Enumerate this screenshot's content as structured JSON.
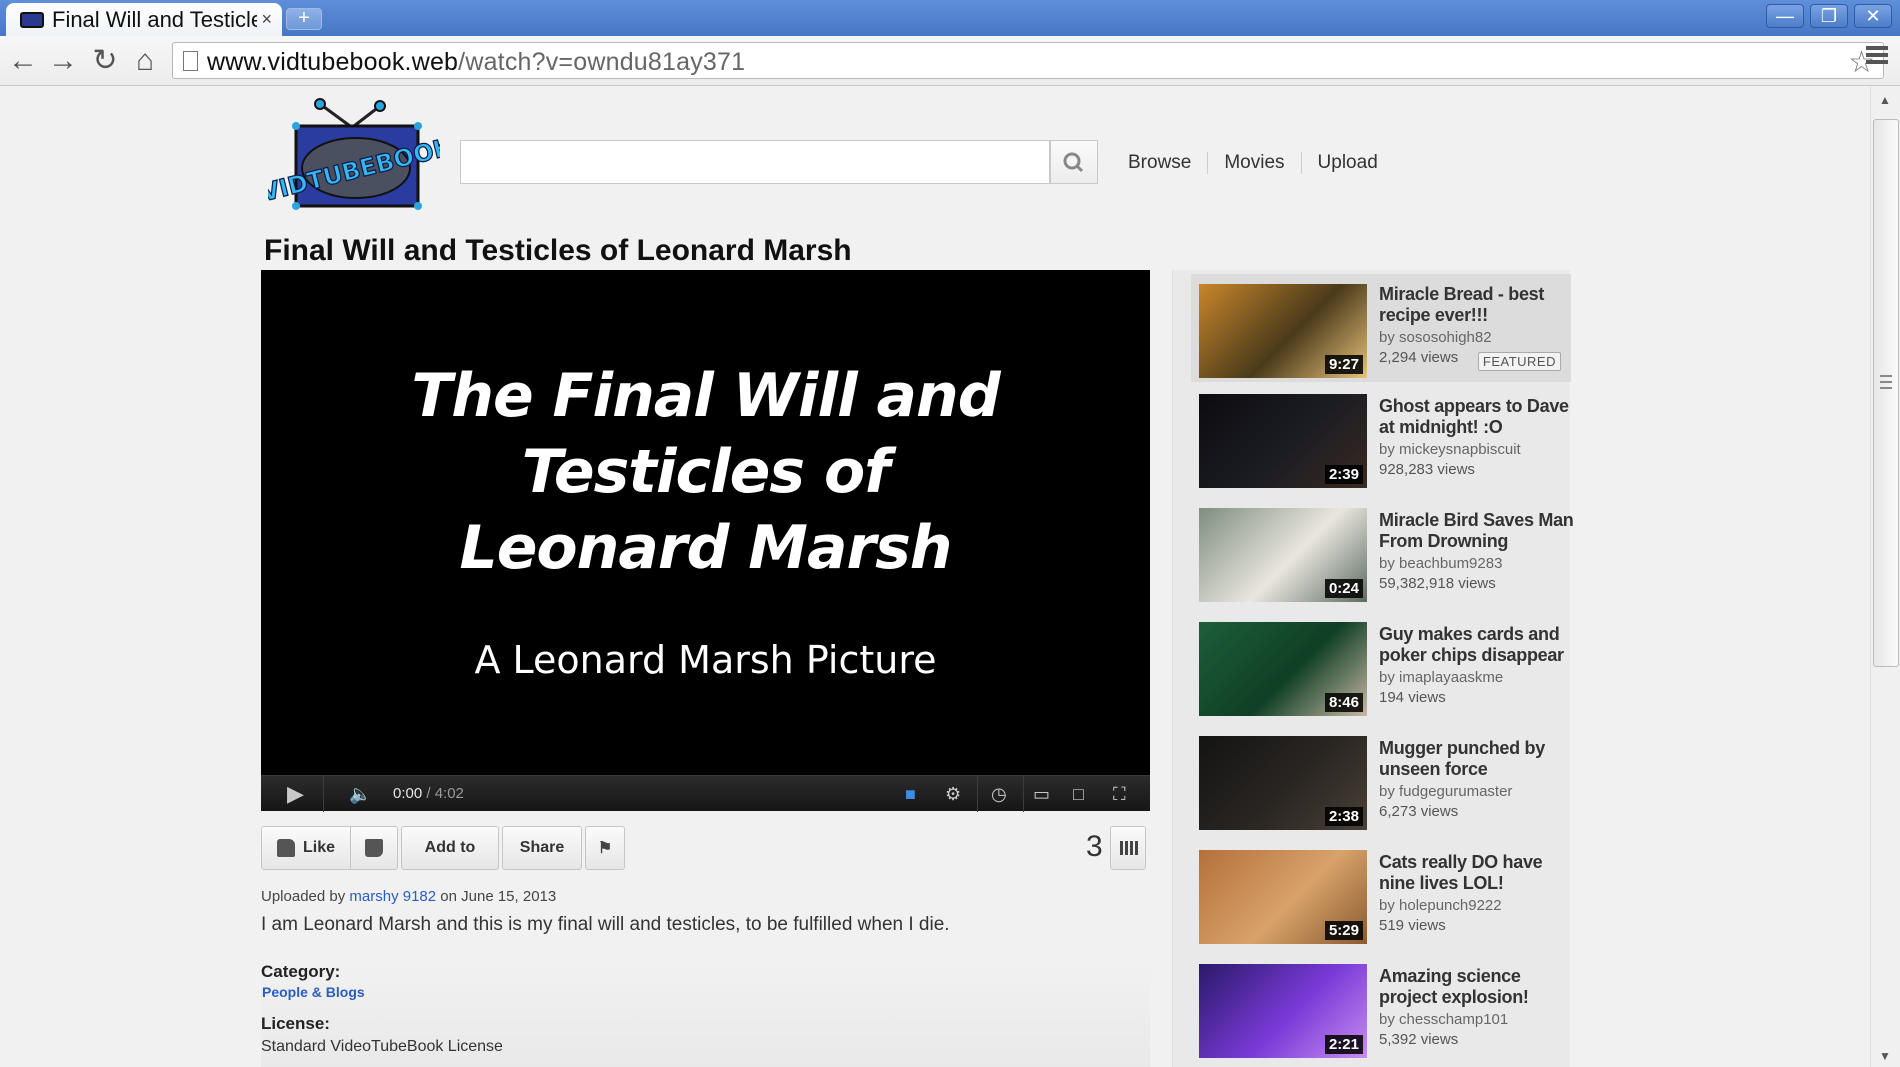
{
  "browser": {
    "tab_title": "Final Will and Testicle",
    "tab_close": "×",
    "new_tab": "+",
    "url_host": "www.vidtubebook.web",
    "url_path": "/watch?v=owndu81ay371"
  },
  "site": {
    "logo_text": "VIDTUBEBOOK",
    "search_placeholder": "",
    "nav": [
      "Browse",
      "Movies",
      "Upload"
    ]
  },
  "video": {
    "title": "Final Will and Testicles of Leonard Marsh",
    "screen_line1": "The Final Will and",
    "screen_line2": "Testicles of",
    "screen_line3": "Leonard Marsh",
    "screen_sub": "A Leonard Marsh Picture",
    "time_current": "0:00",
    "time_total": " / 4:02",
    "views": "3",
    "actions": {
      "like": "Like",
      "add_to": "Add to",
      "share": "Share"
    },
    "uploaded_prefix": "Uploaded by ",
    "uploader": "marshy 9182",
    "uploaded_suffix": " on June 15, 2013",
    "description": "I am Leonard Marsh and this is my final will and testicles, to be fulfilled when I die.",
    "category_label": "Category:",
    "category": "People & Blogs",
    "license_label": "License:",
    "license": "Standard VideoTubeBook License"
  },
  "recommended": [
    {
      "title": "Miracle Bread - best recipe ever!!!",
      "by": "by sososohigh82",
      "views": "2,294 views",
      "duration": "9:27",
      "badge": "FEATURED",
      "thumb_colors": [
        "#c8862b",
        "#4a3a1a",
        "#e7c27a"
      ]
    },
    {
      "title": "Ghost appears to Dave at midnight! :O",
      "by": "by mickeysnapbiscuit",
      "views": "928,283 views",
      "duration": "2:39",
      "thumb_colors": [
        "#0c0c10",
        "#1c1c24",
        "#3a2a20"
      ]
    },
    {
      "title": "Miracle Bird Saves Man From Drowning",
      "by": "by beachbum9283",
      "views": "59,382,918 views",
      "duration": "0:24",
      "thumb_colors": [
        "#7f8d80",
        "#e9e6df",
        "#5c6b60"
      ]
    },
    {
      "title": "Guy makes cards and poker chips disappear",
      "by": "by imaplayaaskme",
      "views": "194 views",
      "duration": "8:46",
      "thumb_colors": [
        "#1d5e3a",
        "#0f3f25",
        "#c9b8a4"
      ]
    },
    {
      "title": "Mugger punched by unseen force",
      "by": "by fudgegurumaster",
      "views": "6,273 views",
      "duration": "2:38",
      "thumb_colors": [
        "#141414",
        "#2a2622",
        "#4a4038"
      ]
    },
    {
      "title": "Cats really DO have nine lives LOL!",
      "by": "by holepunch9222",
      "views": "519 views",
      "duration": "5:29",
      "thumb_colors": [
        "#b5703a",
        "#d8a26a",
        "#8a5a30"
      ]
    },
    {
      "title": "Amazing science project explosion!",
      "by": "by chesschamp101",
      "views": "5,392 views",
      "duration": "2:21",
      "thumb_colors": [
        "#2a1a6a",
        "#7a3ad8",
        "#c88cf0"
      ]
    }
  ]
}
